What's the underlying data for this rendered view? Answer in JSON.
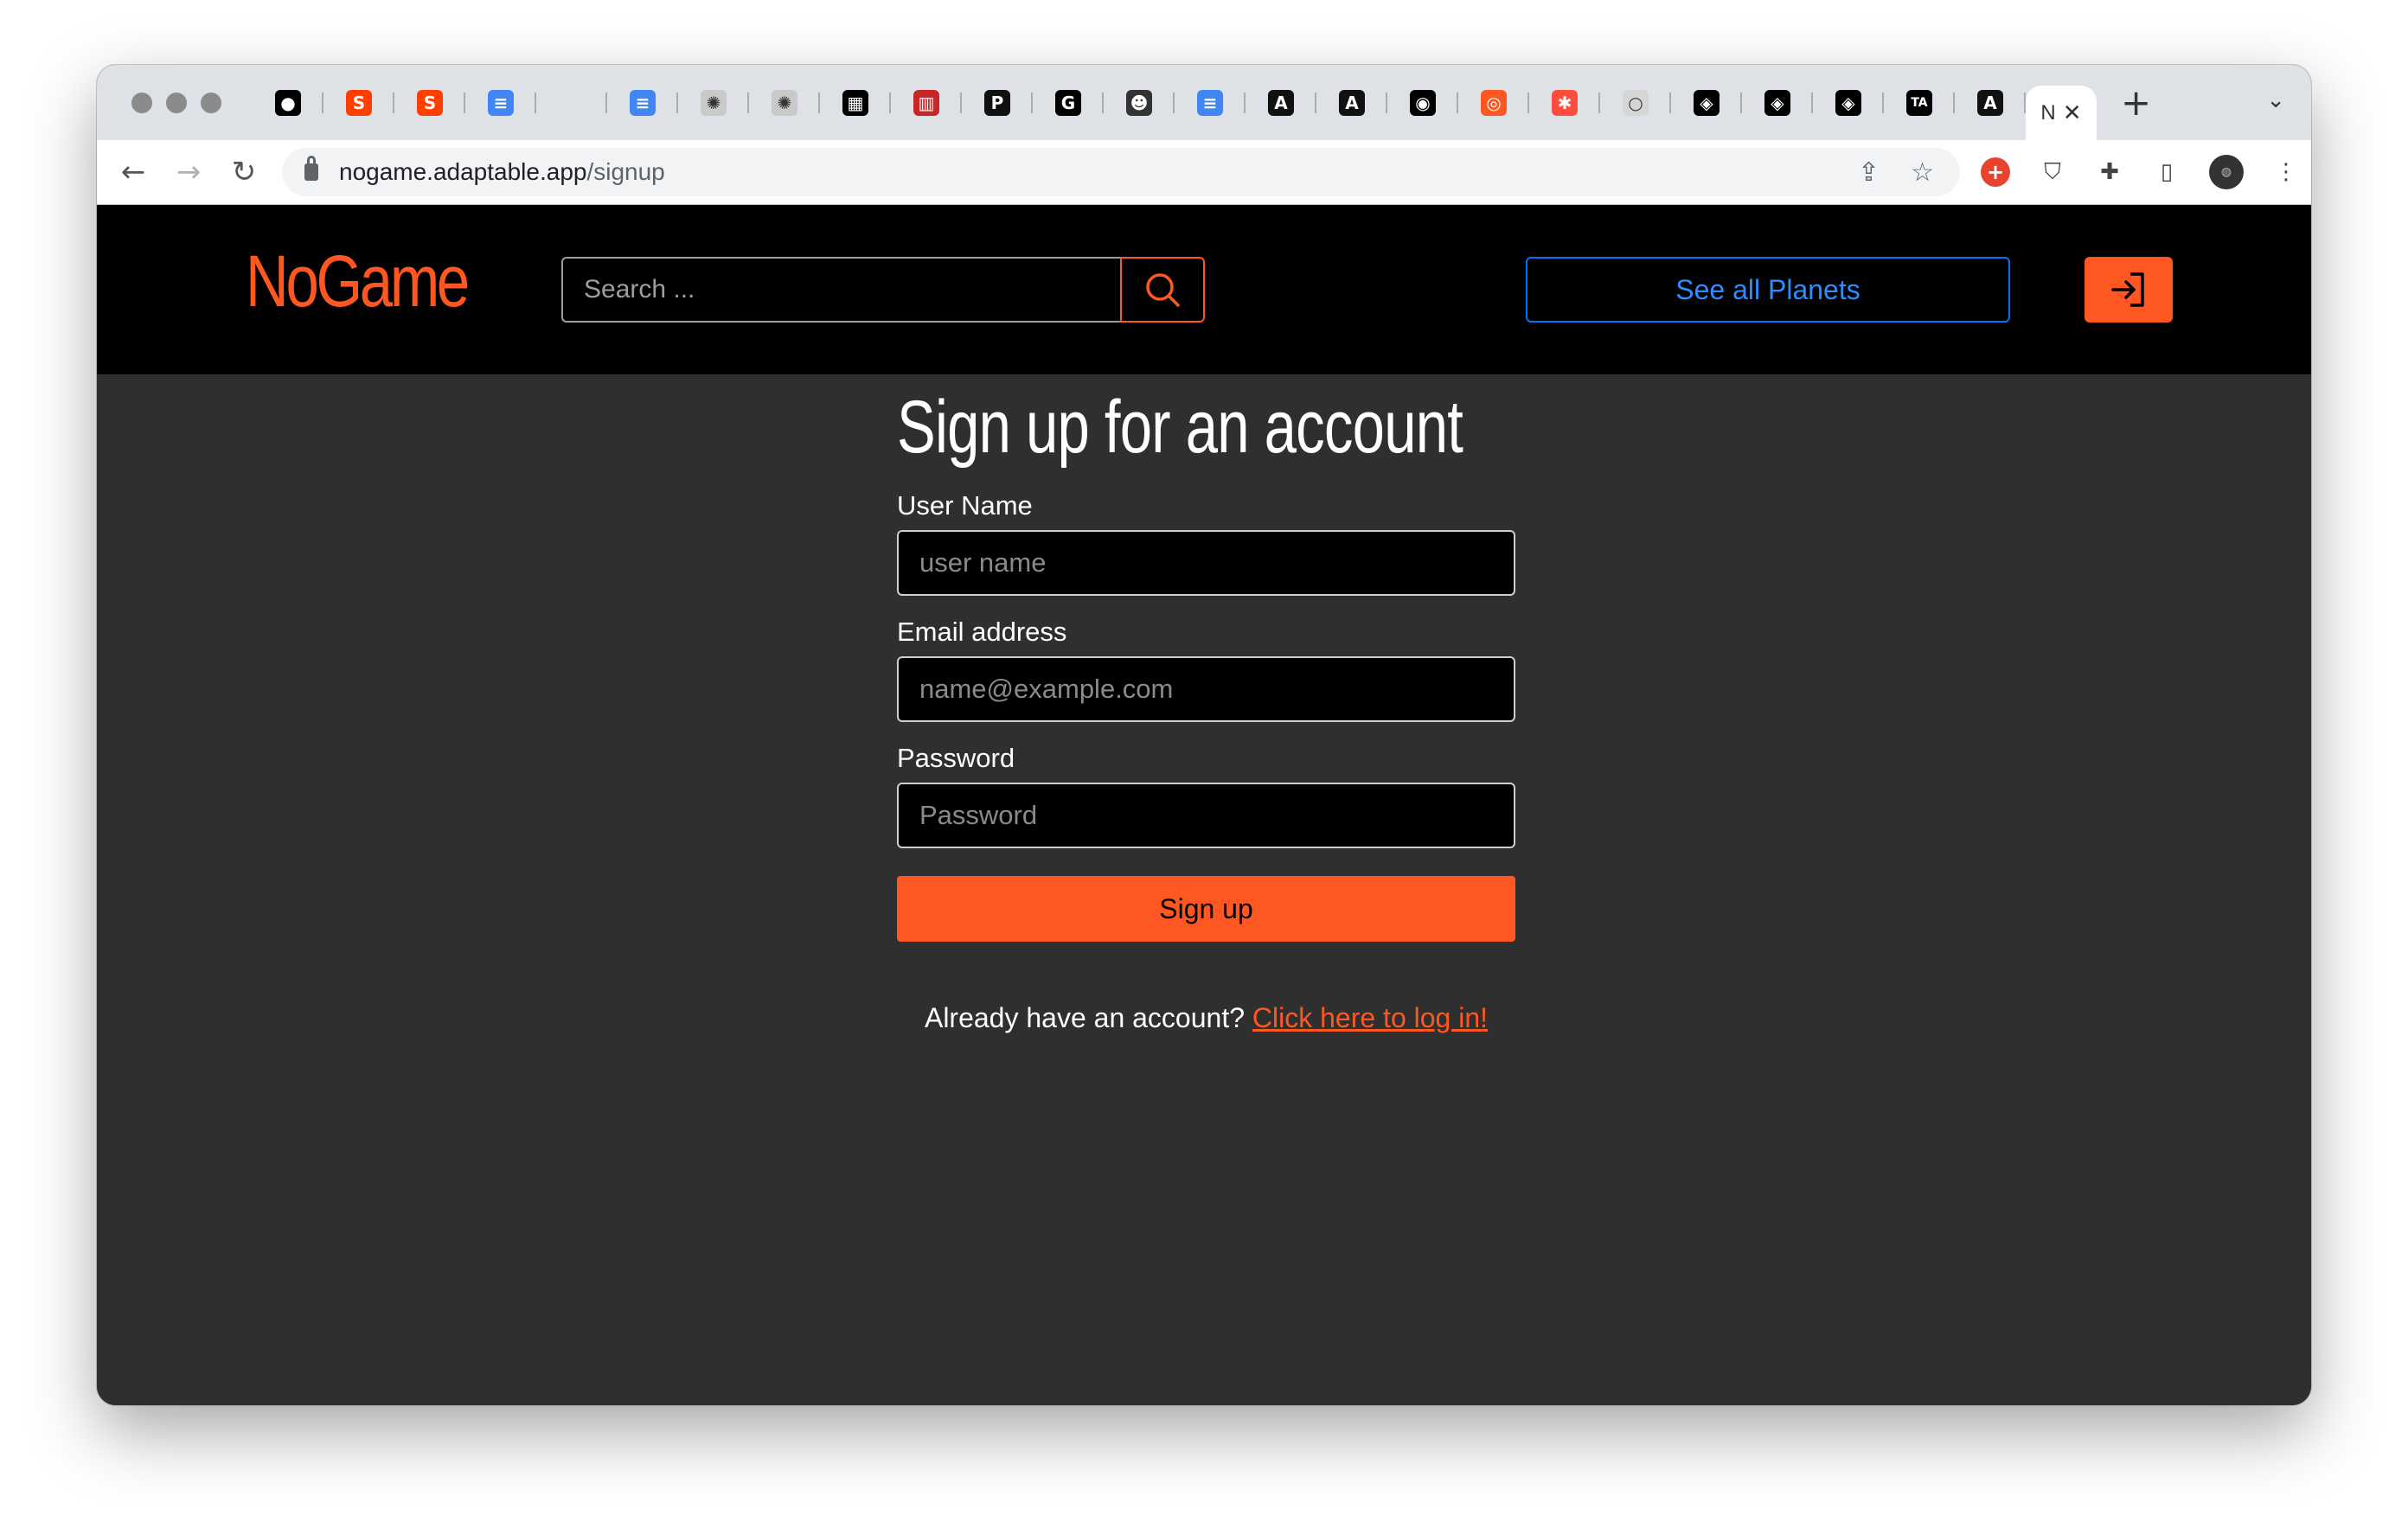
{
  "browser": {
    "tabs": [
      {
        "icon": "medium-icon",
        "glyph": "●",
        "bg": "#000000"
      },
      {
        "icon": "svelte-icon",
        "glyph": "S",
        "bg": "#ff3e00"
      },
      {
        "icon": "svelte-icon",
        "glyph": "S",
        "bg": "#ff3e00"
      },
      {
        "icon": "google-docs-icon",
        "glyph": "≡",
        "bg": "#4285f4"
      },
      {
        "icon": "blank-tab-icon",
        "glyph": "",
        "bg": "transparent"
      },
      {
        "icon": "google-docs-icon",
        "glyph": "≡",
        "bg": "#4285f4"
      },
      {
        "icon": "dotted-circle-icon",
        "glyph": "✺",
        "bg": "#c9c9c9"
      },
      {
        "icon": "dotted-circle-icon",
        "glyph": "✺",
        "bg": "#c9c9c9"
      },
      {
        "icon": "grid-logo-icon",
        "glyph": "▦",
        "bg": "#000000"
      },
      {
        "icon": "museum-icon",
        "glyph": "▥",
        "bg": "#c62828"
      },
      {
        "icon": "p-logo-icon",
        "glyph": "P",
        "bg": "#111111"
      },
      {
        "icon": "g-logo-icon",
        "glyph": "G",
        "bg": "#000000"
      },
      {
        "icon": "head-icon",
        "glyph": "☻",
        "bg": "#333333"
      },
      {
        "icon": "google-docs-icon",
        "glyph": "≡",
        "bg": "#4285f4"
      },
      {
        "icon": "astro-icon",
        "glyph": "A",
        "bg": "#111111"
      },
      {
        "icon": "astro-icon",
        "glyph": "A",
        "bg": "#111111"
      },
      {
        "icon": "github-icon",
        "glyph": "◉",
        "bg": "#000000"
      },
      {
        "icon": "ring-icon",
        "glyph": "◎",
        "bg": "#ff5722"
      },
      {
        "icon": "asterisk-icon",
        "glyph": "✱",
        "bg": "#ff4d3d"
      },
      {
        "icon": "ball-icon",
        "glyph": "○",
        "bg": "#d6d6d6"
      },
      {
        "icon": "codepen-icon",
        "glyph": "◈",
        "bg": "#000000"
      },
      {
        "icon": "codepen-icon",
        "glyph": "◈",
        "bg": "#000000"
      },
      {
        "icon": "codepen-icon",
        "glyph": "◈",
        "bg": "#000000"
      },
      {
        "icon": "ta-logo-icon",
        "glyph": "TA",
        "bg": "#000000"
      },
      {
        "icon": "astro-icon",
        "glyph": "A",
        "bg": "#111111"
      }
    ],
    "active_tab_label": "N",
    "close_glyph": "✕",
    "new_tab_glyph": "+",
    "tab_menu_glyph": "⌄",
    "back_glyph": "←",
    "forward_glyph": "→",
    "reload_glyph": "↻",
    "url_host": "nogame.adaptable.app",
    "url_path": "/signup",
    "share_glyph": "⇪",
    "star_glyph": "☆",
    "ext_add_glyph": "+",
    "ext_shield_glyph": "⛉",
    "ext_puzzle_glyph": "✚",
    "sidepanel_glyph": "▯",
    "menu_glyph": "⋮"
  },
  "header": {
    "logo": "NoGame",
    "search_placeholder": "Search ...",
    "planets_label": "See all Planets"
  },
  "form": {
    "title": "Sign up for an account",
    "username_label": "User Name",
    "username_placeholder": "user name",
    "email_label": "Email address",
    "email_placeholder": "name@example.com",
    "password_label": "Password",
    "password_placeholder": "Password",
    "submit_label": "Sign up",
    "already_text": "Already have an account?",
    "login_link": "Click here to log in!"
  },
  "colors": {
    "brand": "#ff5722",
    "header_bg": "#000000",
    "page_bg": "#2f2f2f",
    "planets_btn": "#0d6efd"
  }
}
